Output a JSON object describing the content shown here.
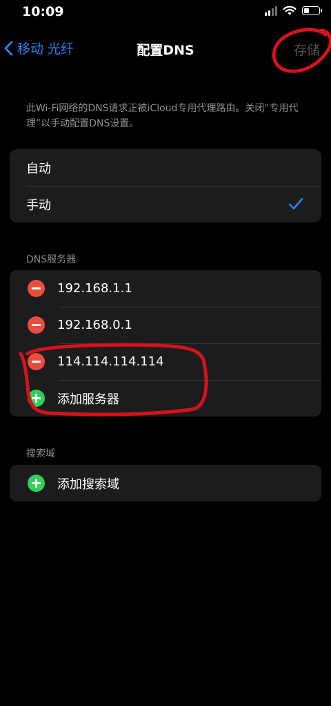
{
  "status_bar": {
    "time": "10:09"
  },
  "nav": {
    "back_label": "移动 光纤",
    "title": "配置DNS",
    "save_label": "存储"
  },
  "description": "此Wi-Fi网络的DNS请求正被iCloud专用代理路由。关闭“专用代理”以手动配置DNS设置。",
  "config_mode": {
    "options": [
      {
        "label": "自动",
        "selected": false
      },
      {
        "label": "手动",
        "selected": true
      }
    ]
  },
  "dns": {
    "header": "DNS服务器",
    "servers": [
      "192.168.1.1",
      "192.168.0.1",
      "114.114.114.114"
    ],
    "add_label": "添加服务器"
  },
  "search_domains": {
    "header": "搜索域",
    "add_label": "添加搜索域"
  },
  "colors": {
    "accent": "#2f82f7",
    "delete": "#eb4d3d",
    "add": "#30d158",
    "annotation": "#d5121e"
  },
  "icons": [
    "chevron-left-icon",
    "signal-icon",
    "wifi-icon",
    "battery-icon",
    "checkmark-icon",
    "minus-circle-icon",
    "plus-circle-icon"
  ]
}
